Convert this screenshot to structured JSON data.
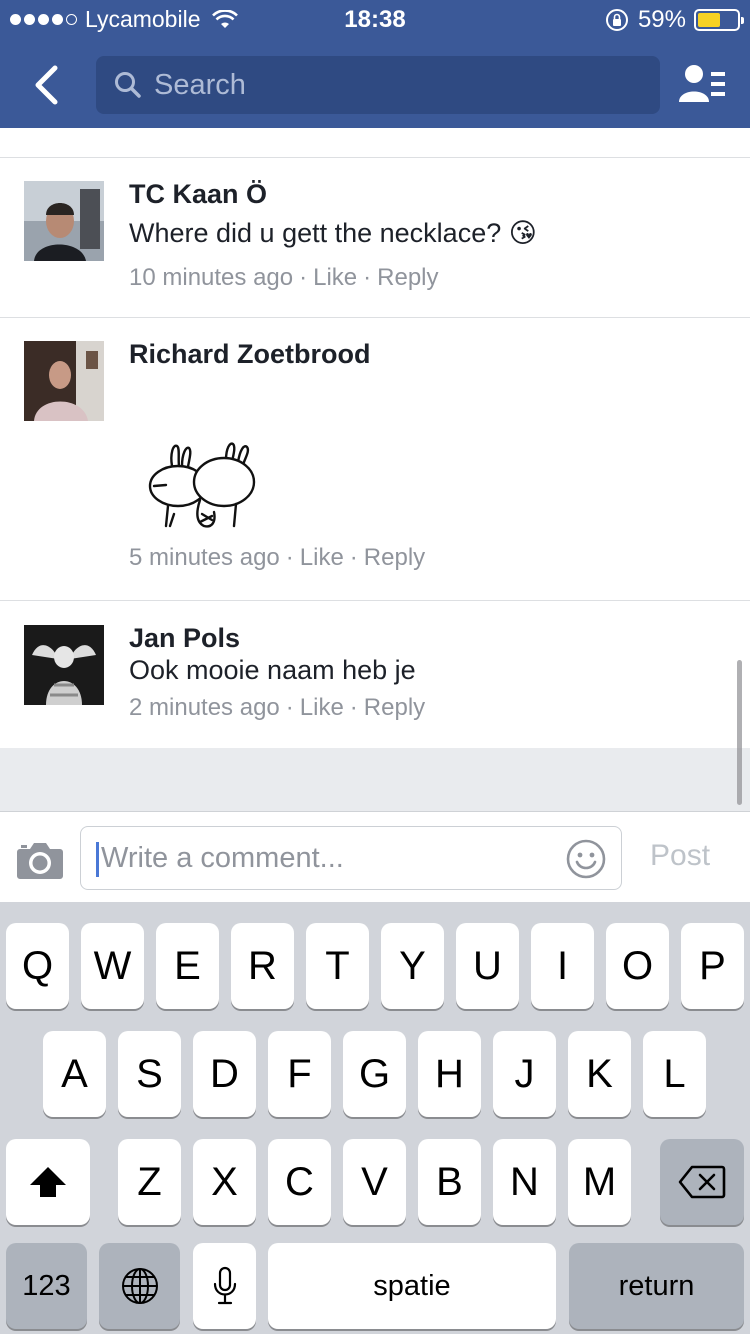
{
  "status_bar": {
    "carrier": "Lycamobile",
    "time": "18:38",
    "battery": "59%",
    "battery_level": 0.59,
    "signal_bars": 4
  },
  "nav": {
    "search_placeholder": "Search"
  },
  "comments": [
    {
      "author": "TC Kaan Ö",
      "text": "Where did u gett the necklace? 😘",
      "time": "10 minutes ago",
      "like": "Like",
      "reply": "Reply",
      "sep": "·"
    },
    {
      "author": "Richard Zoetbrood",
      "text": "",
      "time": "5 minutes ago",
      "like": "Like",
      "reply": "Reply",
      "sep": "·"
    },
    {
      "author": "Jan Pols",
      "text": "Ook mooie naam heb je",
      "time": "2 minutes ago",
      "like": "Like",
      "reply": "Reply",
      "sep": "·"
    }
  ],
  "composer": {
    "placeholder": "Write a comment...",
    "post_label": "Post"
  },
  "keyboard": {
    "row1": [
      "Q",
      "W",
      "E",
      "R",
      "T",
      "Y",
      "U",
      "I",
      "O",
      "P"
    ],
    "row2": [
      "A",
      "S",
      "D",
      "F",
      "G",
      "H",
      "J",
      "K",
      "L"
    ],
    "row3": [
      "Z",
      "X",
      "C",
      "V",
      "B",
      "N",
      "M"
    ],
    "numbers_label": "123",
    "space_label": "spatie",
    "return_label": "return"
  },
  "colors": {
    "brand": "#3b5998",
    "meta_text": "#90949c",
    "battery_fill": "#f7d224"
  }
}
